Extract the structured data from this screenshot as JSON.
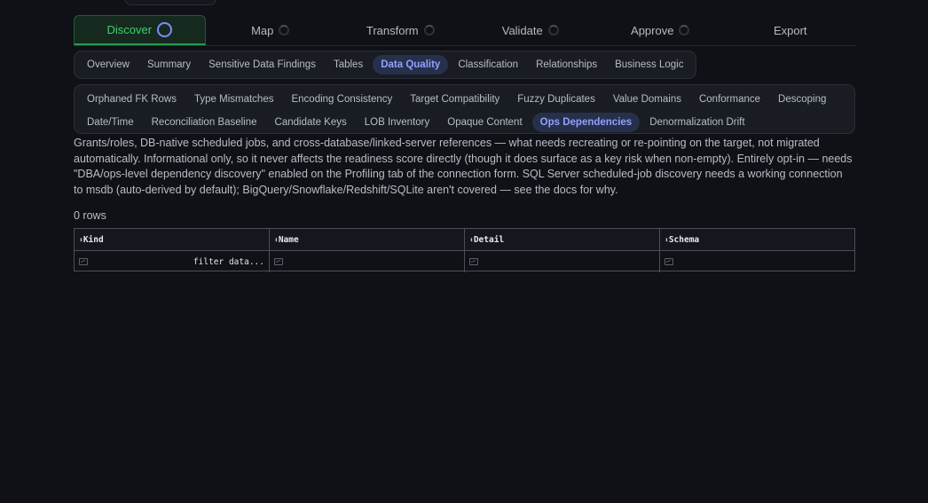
{
  "stepper": [
    {
      "label": "Discover",
      "active": true
    },
    {
      "label": "Map",
      "active": false
    },
    {
      "label": "Transform",
      "active": false
    },
    {
      "label": "Validate",
      "active": false
    },
    {
      "label": "Approve",
      "active": false
    },
    {
      "label": "Export",
      "active": false
    }
  ],
  "tabs_primary": [
    {
      "label": "Overview"
    },
    {
      "label": "Summary"
    },
    {
      "label": "Sensitive Data Findings"
    },
    {
      "label": "Tables"
    },
    {
      "label": "Data Quality",
      "active": true
    },
    {
      "label": "Classification"
    },
    {
      "label": "Relationships"
    },
    {
      "label": "Business Logic"
    }
  ],
  "tabs_secondary_row1": [
    {
      "label": "Orphaned FK Rows"
    },
    {
      "label": "Type Mismatches"
    },
    {
      "label": "Encoding Consistency"
    },
    {
      "label": "Target Compatibility"
    },
    {
      "label": "Fuzzy Duplicates"
    },
    {
      "label": "Value Domains"
    },
    {
      "label": "Conformance"
    },
    {
      "label": "Descoping"
    }
  ],
  "tabs_secondary_row2": [
    {
      "label": "Date/Time"
    },
    {
      "label": "Reconciliation Baseline"
    },
    {
      "label": "Candidate Keys"
    },
    {
      "label": "LOB Inventory"
    },
    {
      "label": "Opaque Content"
    },
    {
      "label": "Ops Dependencies",
      "active": true
    },
    {
      "label": "Denormalization Drift"
    }
  ],
  "description": "Grants/roles, DB-native scheduled jobs, and cross-database/linked-server references — what needs recreating or re-pointing on the target, not migrated automatically. Informational only, so it never affects the readiness score directly (though it does surface as a key risk when non-empty). Entirely opt-in — needs \"DBA/ops-level dependency discovery\" enabled on the Profiling tab of the connection form. SQL Server scheduled-job discovery needs a working connection to msdb (auto-derived by default); BigQuery/Snowflake/Redshift/SQLite aren't covered — see the docs for why.",
  "row_count": "0 rows",
  "table": {
    "columns": [
      "Kind",
      "Name",
      "Detail",
      "Schema"
    ],
    "filter_placeholder": "filter data..."
  },
  "colors": {
    "background": "#0f1116",
    "accent_green": "#3dd16b",
    "accent_blue": "#8fa1ff"
  }
}
